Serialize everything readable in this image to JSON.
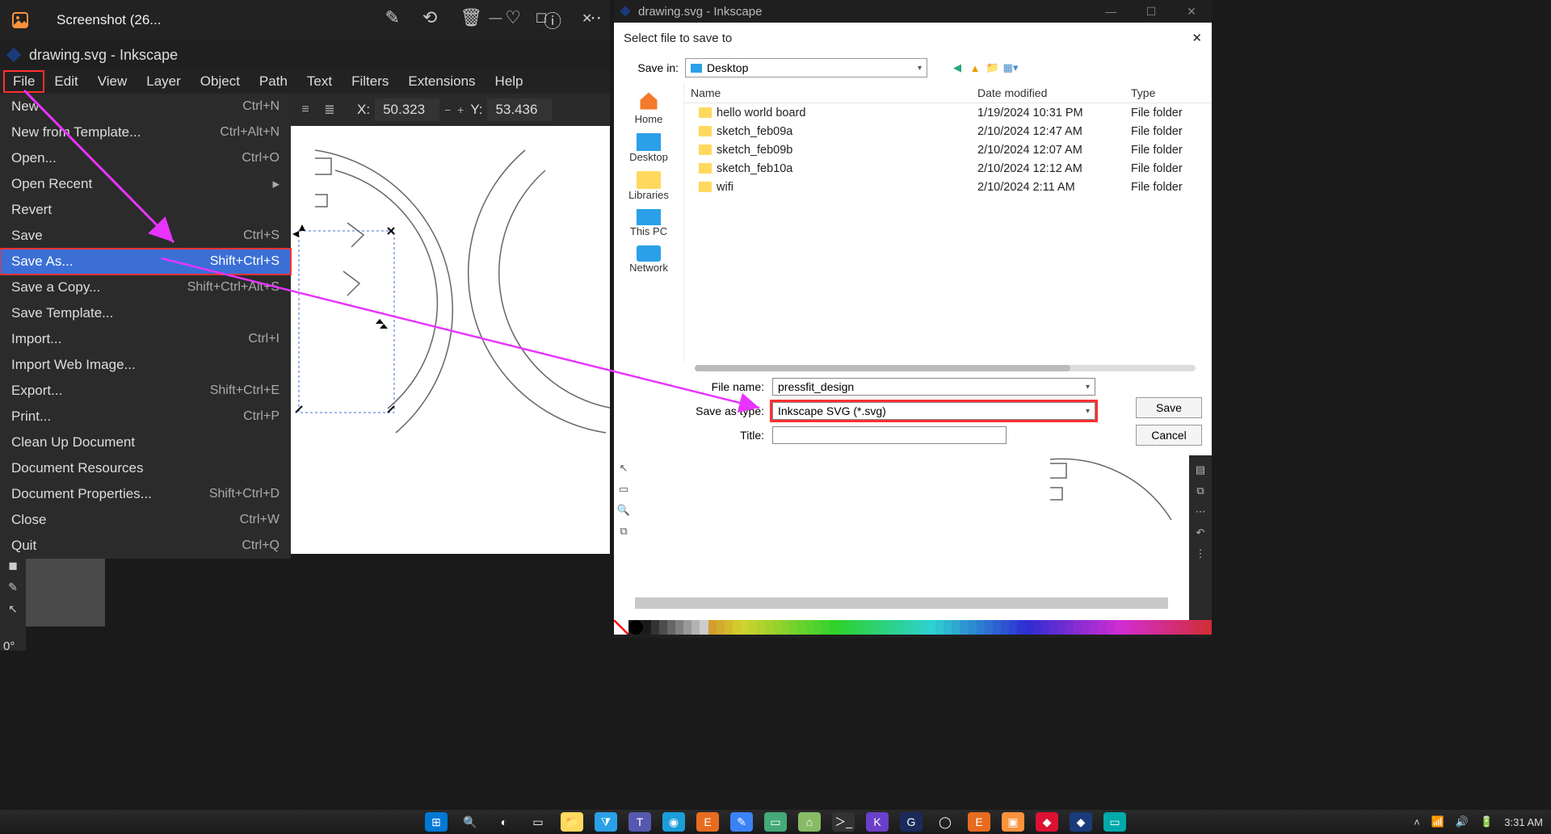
{
  "photoViewer": {
    "title": "Screenshot (26...",
    "windowControls": {
      "min": "—",
      "max": "☐",
      "close": "✕"
    }
  },
  "inkscape": {
    "titleBar": "drawing.svg - Inkscape",
    "menuBar": [
      "File",
      "Edit",
      "View",
      "Layer",
      "Object",
      "Path",
      "Text",
      "Filters",
      "Extensions",
      "Help"
    ],
    "coords": {
      "xLabel": "X:",
      "xVal": "50.323",
      "yLabel": "Y:",
      "yVal": "53.436"
    },
    "fileMenu": [
      {
        "label": "New",
        "shortcut": "Ctrl+N"
      },
      {
        "label": "New from Template...",
        "shortcut": "Ctrl+Alt+N"
      },
      {
        "label": "Open...",
        "shortcut": "Ctrl+O"
      },
      {
        "label": "Open Recent",
        "shortcut": "",
        "submenu": true
      },
      {
        "label": "Revert",
        "shortcut": ""
      },
      {
        "label": "Save",
        "shortcut": "Ctrl+S"
      },
      {
        "label": "Save As...",
        "shortcut": "Shift+Ctrl+S",
        "selected": true
      },
      {
        "label": "Save a Copy...",
        "shortcut": "Shift+Ctrl+Alt+S"
      },
      {
        "label": "Save Template...",
        "shortcut": ""
      },
      {
        "label": "Import...",
        "shortcut": "Ctrl+I"
      },
      {
        "label": "Import Web Image...",
        "shortcut": ""
      },
      {
        "label": "Export...",
        "shortcut": "Shift+Ctrl+E"
      },
      {
        "label": "Print...",
        "shortcut": "Ctrl+P"
      },
      {
        "label": "Clean Up Document",
        "shortcut": ""
      },
      {
        "label": "Document Resources",
        "shortcut": ""
      },
      {
        "label": "Document Properties...",
        "shortcut": "Shift+Ctrl+D"
      },
      {
        "label": "Close",
        "shortcut": "Ctrl+W"
      },
      {
        "label": "Quit",
        "shortcut": "Ctrl+Q"
      }
    ],
    "rotation": "0°"
  },
  "inkscape2": {
    "titleBar": "drawing.svg - Inkscape"
  },
  "saveDialog": {
    "header": "Select file to save to",
    "saveInLabel": "Save in:",
    "saveInValue": "Desktop",
    "sidebar": [
      "Home",
      "Desktop",
      "Libraries",
      "This PC",
      "Network"
    ],
    "columns": [
      "Name",
      "Date modified",
      "Type"
    ],
    "rows": [
      {
        "name": "hello world board",
        "date": "1/19/2024 10:31 PM",
        "type": "File folder"
      },
      {
        "name": "sketch_feb09a",
        "date": "2/10/2024 12:47 AM",
        "type": "File folder"
      },
      {
        "name": "sketch_feb09b",
        "date": "2/10/2024 12:07 AM",
        "type": "File folder"
      },
      {
        "name": "sketch_feb10a",
        "date": "2/10/2024 12:12 AM",
        "type": "File folder"
      },
      {
        "name": "wifi",
        "date": "2/10/2024 2:11 AM",
        "type": "File folder"
      }
    ],
    "fileNameLabel": "File name:",
    "fileNameValue": "pressfit_design",
    "saveTypeLabel": "Save as type:",
    "saveTypeValue": "Inkscape SVG (*.svg)",
    "titleLabel": "Title:",
    "titleValue": "",
    "saveBtn": "Save",
    "cancelBtn": "Cancel"
  },
  "taskbar": {
    "time": "3:31 AM"
  }
}
